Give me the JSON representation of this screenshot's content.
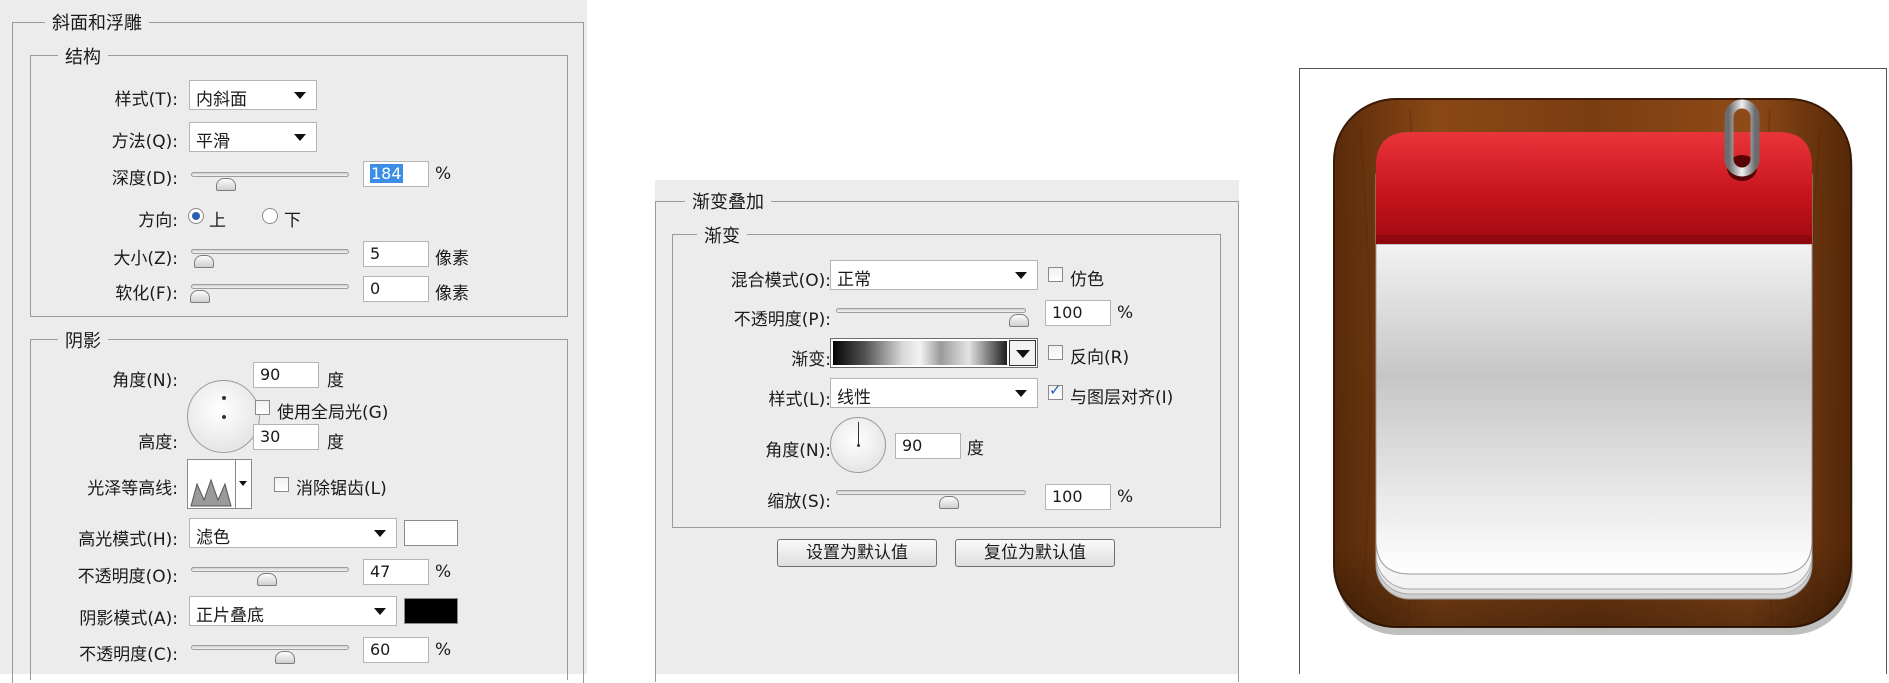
{
  "bevel": {
    "section_title": "斜面和浮雕",
    "structure": {
      "title": "结构",
      "style_label": "样式(T):",
      "style_value": "内斜面",
      "technique_label": "方法(Q):",
      "technique_value": "平滑",
      "depth_label": "深度(D):",
      "depth_value": "184",
      "depth_unit": "%",
      "depth_level": 0.18,
      "direction_label": "方向:",
      "direction_up": "上",
      "direction_down": "下",
      "size_label": "大小(Z):",
      "size_value": "5",
      "size_unit": "像素",
      "size_level": 0.03,
      "soften_label": "软化(F):",
      "soften_value": "0",
      "soften_unit": "像素",
      "soften_level": 0.0
    },
    "shading": {
      "title": "阴影",
      "angle_label": "角度(N):",
      "angle_value": "90",
      "angle_unit": "度",
      "global_light_label": "使用全局光(G)",
      "altitude_label": "高度:",
      "altitude_value": "30",
      "altitude_unit": "度",
      "gloss_label": "光泽等高线:",
      "antialias_label": "消除锯齿(L)",
      "highlight_mode_label": "高光模式(H):",
      "highlight_mode_value": "滤色",
      "highlight_color": "#ffffff",
      "highlight_opacity_label": "不透明度(O):",
      "highlight_opacity_value": "47",
      "highlight_opacity_unit": "%",
      "highlight_opacity_level": 0.47,
      "shadow_mode_label": "阴影模式(A):",
      "shadow_mode_value": "正片叠底",
      "shadow_color": "#000000",
      "shadow_opacity_label": "不透明度(C):",
      "shadow_opacity_value": "60",
      "shadow_opacity_unit": "%",
      "shadow_opacity_level": 0.6
    }
  },
  "gradient_overlay": {
    "section_title": "渐变叠加",
    "group_title": "渐变",
    "blend_label": "混合模式(O):",
    "blend_value": "正常",
    "dither_label": "仿色",
    "opacity_label": "不透明度(P):",
    "opacity_value": "100",
    "opacity_unit": "%",
    "opacity_level": 1.0,
    "gradient_label": "渐变:",
    "reverse_label": "反向(R)",
    "style_label": "样式(L):",
    "style_value": "线性",
    "align_label": "与图层对齐(I)",
    "angle_label": "角度(N):",
    "angle_value": "90",
    "angle_unit": "度",
    "scale_label": "缩放(S):",
    "scale_value": "100",
    "scale_unit": "%",
    "scale_level": 0.6,
    "make_default_button": "设置为默认值",
    "reset_default_button": "复位为默认值"
  },
  "colors": {
    "panel_bg": "#ececec",
    "selection": "#3a8ee6",
    "calendar_red": "#c8141c",
    "wood": "#7a3d12"
  }
}
